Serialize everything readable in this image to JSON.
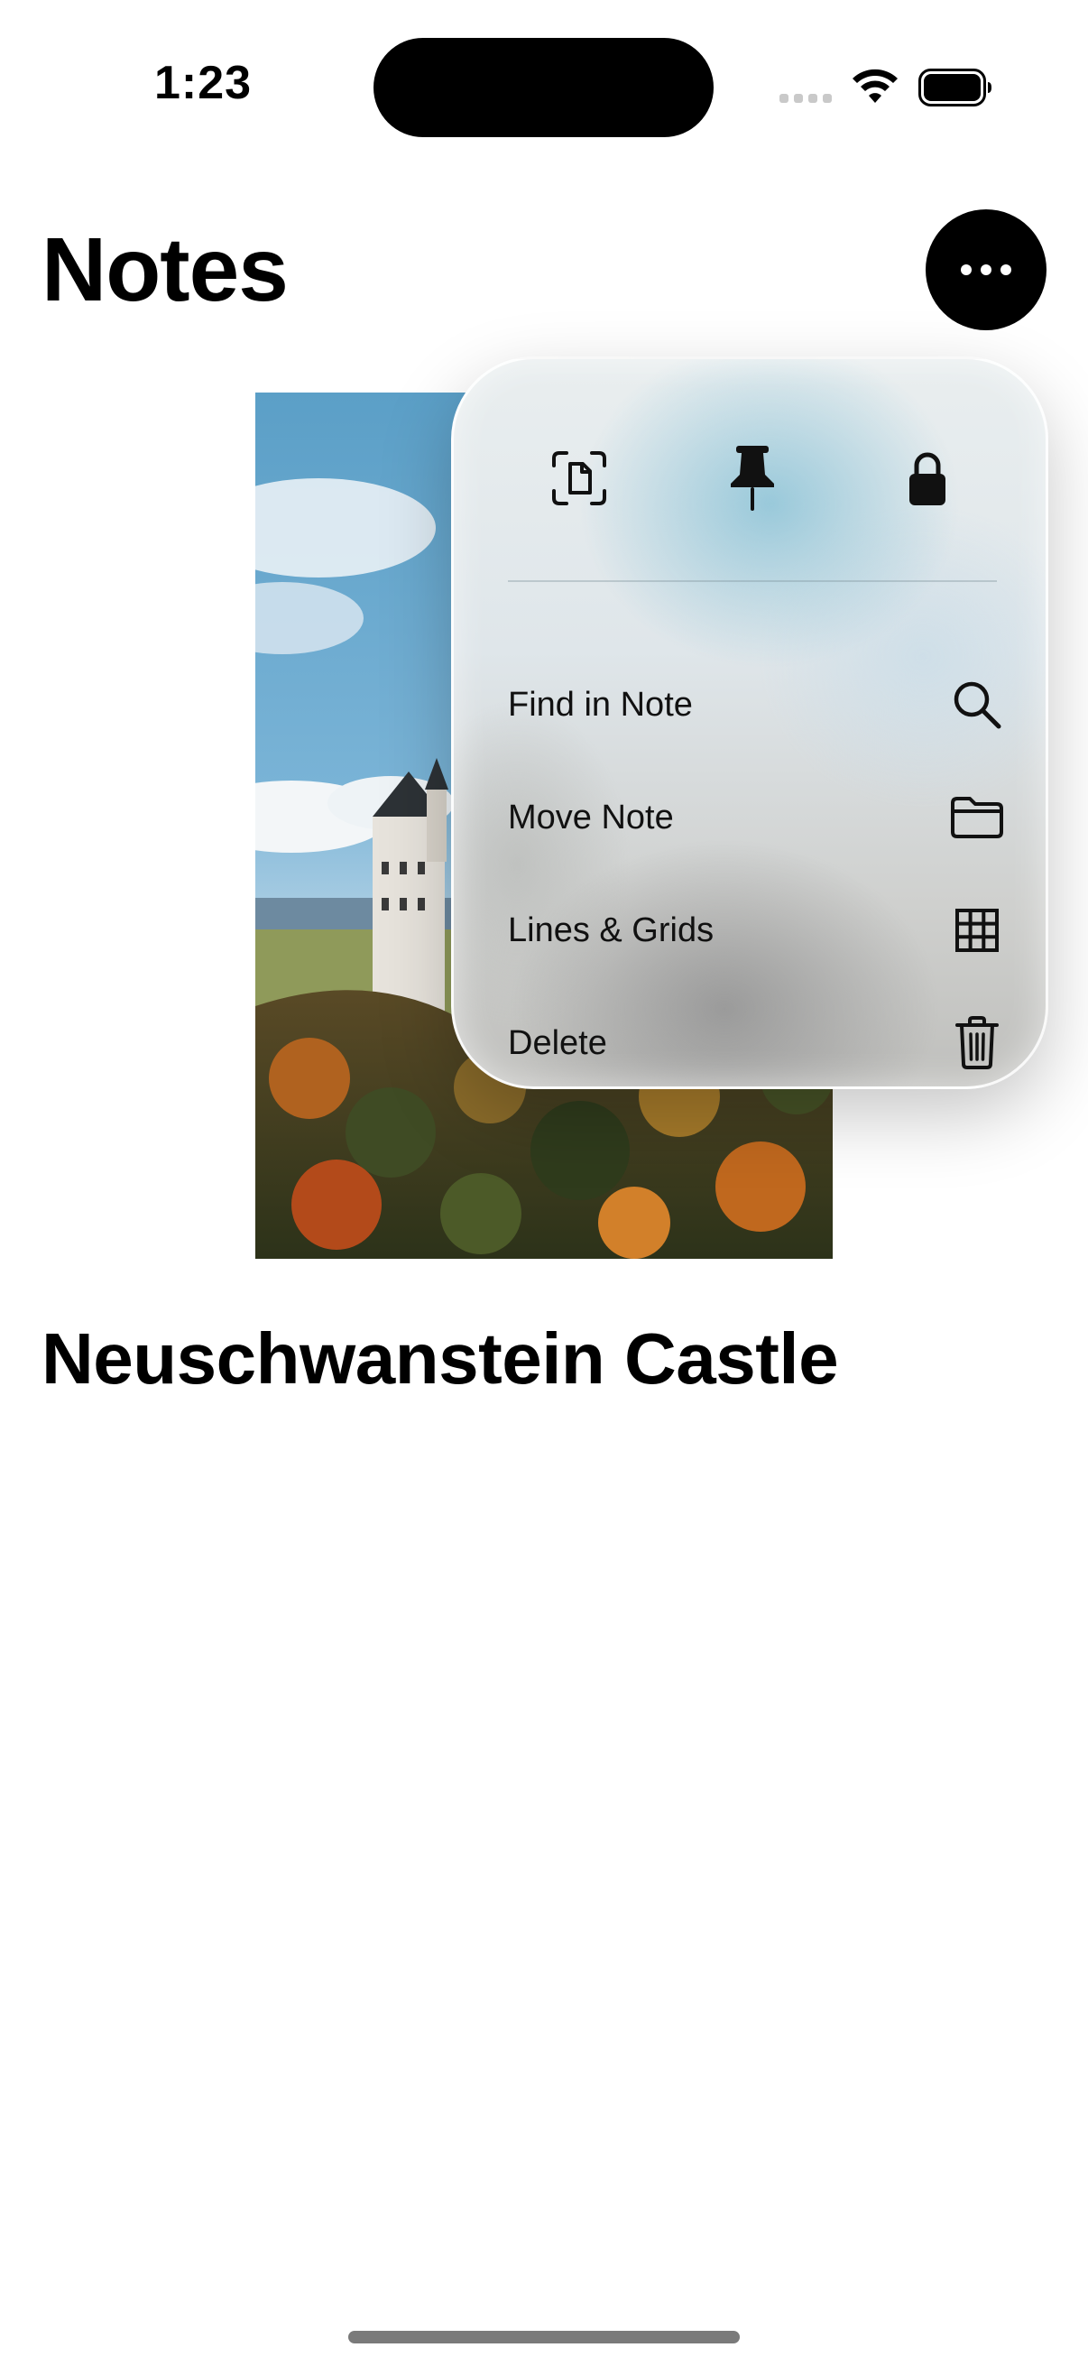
{
  "status_bar": {
    "time": "1:23"
  },
  "header": {
    "title": "Notes",
    "more_icon": "ellipsis-icon"
  },
  "note": {
    "title": "Neuschwanstein Castle",
    "image_subject": "castle-photo"
  },
  "menu": {
    "top_actions": [
      {
        "icon": "scan-document-icon"
      },
      {
        "icon": "pin-icon"
      },
      {
        "icon": "lock-icon"
      }
    ],
    "items": [
      {
        "label": "Find in Note",
        "icon": "magnifying-glass-icon"
      },
      {
        "label": "Move Note",
        "icon": "folder-icon"
      },
      {
        "label": "Lines & Grids",
        "icon": "grid-icon"
      },
      {
        "label": "Delete",
        "icon": "trash-icon"
      }
    ]
  },
  "colors": {
    "accent": "#000000",
    "background": "#ffffff"
  }
}
